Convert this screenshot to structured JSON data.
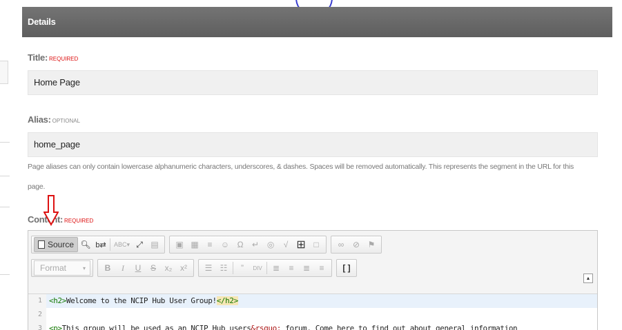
{
  "panel": {
    "header_title": "Details"
  },
  "title_field": {
    "label": "Title:",
    "flag": "REQUIRED",
    "value": "Home Page"
  },
  "alias_field": {
    "label": "Alias:",
    "flag": "OPTIONAL",
    "value": "home_page",
    "hint_line1": "Page aliases can only contain lowercase alphanumeric characters, underscores, & dashes. Spaces will be removed automatically. This represents the segment in the URL for this",
    "hint_line2": "page."
  },
  "content_field": {
    "label": "Content:",
    "flag": "REQUIRED"
  },
  "editor": {
    "source_label": "Source",
    "format_label": "Format",
    "code_lines": [
      {
        "num": "1",
        "open_tag": "<h2>",
        "text": "Welcome to the NCIP Hub User Group!",
        "close_tag": "</h2>"
      },
      {
        "num": "2",
        "text": ""
      },
      {
        "num": "3",
        "open_tag": "<p>",
        "text": "This group will be used as an NCIP Hub users",
        "entity": "&rsquo;",
        "text2": " forum. Come here to find out about general information"
      }
    ],
    "icons": [
      "source-icon",
      "find-icon",
      "replace-icon",
      "spellcheck-icon",
      "maximize-icon",
      "showblocks-icon",
      "image-icon",
      "table-icon",
      "horizontal-rule-icon",
      "smiley-icon",
      "special-char-icon",
      "page-break-icon",
      "iframe-icon",
      "math-icon",
      "grid-icon",
      "template-icon",
      "link-icon",
      "unlink-icon",
      "anchor-icon",
      "bold-icon",
      "italic-icon",
      "underline-icon",
      "strike-icon",
      "subscript-icon",
      "superscript-icon",
      "ordered-list-icon",
      "unordered-list-icon",
      "blockquote-icon",
      "div-icon",
      "align-left-icon",
      "align-center-icon",
      "align-right-icon",
      "justify-icon",
      "bracket-icon",
      "collapse-icon"
    ]
  },
  "colors": {
    "header_bg": "#6b6b6b",
    "required": "#dd1111",
    "annotation_arrow": "#dd1111",
    "annotation_circle": "#3b3fd0"
  }
}
